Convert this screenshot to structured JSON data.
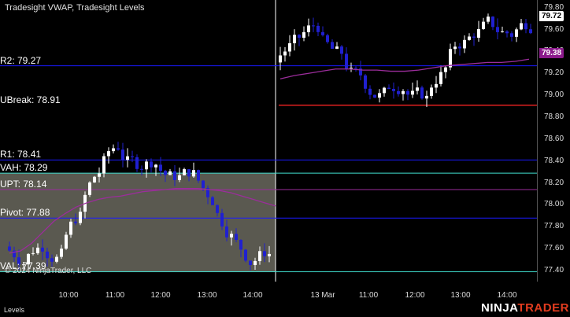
{
  "window": {
    "indicators_title": "Tradesight VWAP, Tradesight Levels",
    "copyright": "© 2024 NinjaTrader, LLC",
    "panel_tab": "Levels",
    "logo_text_a": "NINJA",
    "logo_text_b": "TRADER"
  },
  "levels": [
    {
      "name": "R2",
      "label": "R2: 79.27",
      "price": 79.27,
      "color": "#1a1aff"
    },
    {
      "name": "UBreak",
      "label": "UBreak: 78.91",
      "price": 78.91,
      "color": "#e02020"
    },
    {
      "name": "R1",
      "label": "R1: 78.41",
      "price": 78.41,
      "color": "#1a1aff"
    },
    {
      "name": "VAH",
      "label": "VAH: 78.29",
      "price": 78.29,
      "color": "#40e0d0"
    },
    {
      "name": "UPT",
      "label": "UPT: 78.14",
      "price": 78.14,
      "color": "#9b2d9b"
    },
    {
      "name": "Pivot",
      "label": "Pivot: 77.88",
      "price": 77.88,
      "color": "#1a1aff"
    },
    {
      "name": "VAL",
      "label": "VAL: 77.39",
      "price": 77.39,
      "color": "#40e0d0"
    }
  ],
  "value_area_color": "#5a5950",
  "price_axis": {
    "ticks": [
      "79.80",
      "79.60",
      "79.40",
      "79.20",
      "79.00",
      "78.80",
      "78.60",
      "78.40",
      "78.20",
      "78.00",
      "77.80",
      "77.60",
      "77.40"
    ],
    "min": 77.3,
    "max": 79.87,
    "last_price": "79.72",
    "vwap_price": "79.38"
  },
  "time_axis": {
    "ticks": [
      "10:00",
      "11:00",
      "12:00",
      "13:00",
      "14:00",
      "13 Mar",
      "11:00",
      "12:00",
      "13:00",
      "14:00"
    ]
  },
  "colors": {
    "up_bar": "#ffffff",
    "down_bar": "#2020d0",
    "vwap": "#9b2d9b",
    "session_break": "#ffffff"
  },
  "chart_data": {
    "type": "line",
    "title": "",
    "series": [
      {
        "name": "Tradesight VWAP",
        "values": [
          77.56,
          77.58,
          77.65,
          77.75,
          77.85,
          77.92,
          77.98,
          78.02,
          78.05,
          78.07,
          78.08,
          78.1,
          78.12,
          78.13,
          78.14,
          78.15,
          78.15,
          78.15,
          78.14,
          78.13,
          78.11,
          78.08,
          78.05,
          78.02,
          77.99,
          79.15,
          79.18,
          79.2,
          79.22,
          79.24,
          79.24,
          79.23,
          79.23,
          79.22,
          79.22,
          79.23,
          79.25,
          79.27,
          79.28,
          79.29,
          79.3,
          79.3,
          79.31,
          79.33
        ]
      }
    ],
    "ylim": [
      77.3,
      79.87
    ]
  }
}
